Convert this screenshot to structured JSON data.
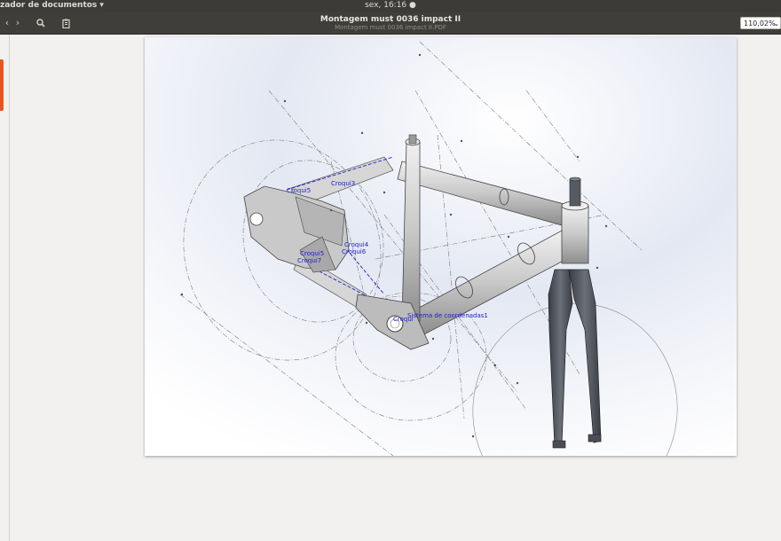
{
  "topbar": {
    "app_menu": "zador de documentos ▾",
    "clock": "sex, 16:16 ●"
  },
  "headerbar": {
    "title": "Montagem must 0036  impact II",
    "subtitle": "Montagem must 0036  impact II.PDF",
    "zoom_value": "110,02%"
  },
  "icons": {
    "prev": "chevron-left-icon",
    "next": "chevron-right-icon",
    "search": "search-icon",
    "annotations": "clipboard-icon",
    "zoom_dropdown": "chevron-down-icon"
  },
  "drawing": {
    "labels": {
      "sketch_a": "Croqui5",
      "sketch_b": "Croqui3",
      "sketch_c": "Croqui4",
      "sketch_d": "Croqui6",
      "sketch_e": "Croqui5",
      "sketch_f": "Croqui7",
      "coord": "Sistema de coordenadas1",
      "coord_short": "Croqui"
    }
  },
  "colors": {
    "accent": "#e95420",
    "topbar": "#3c3b37",
    "fork": "#4a4d55",
    "sketch_blue": "#2020d0"
  }
}
